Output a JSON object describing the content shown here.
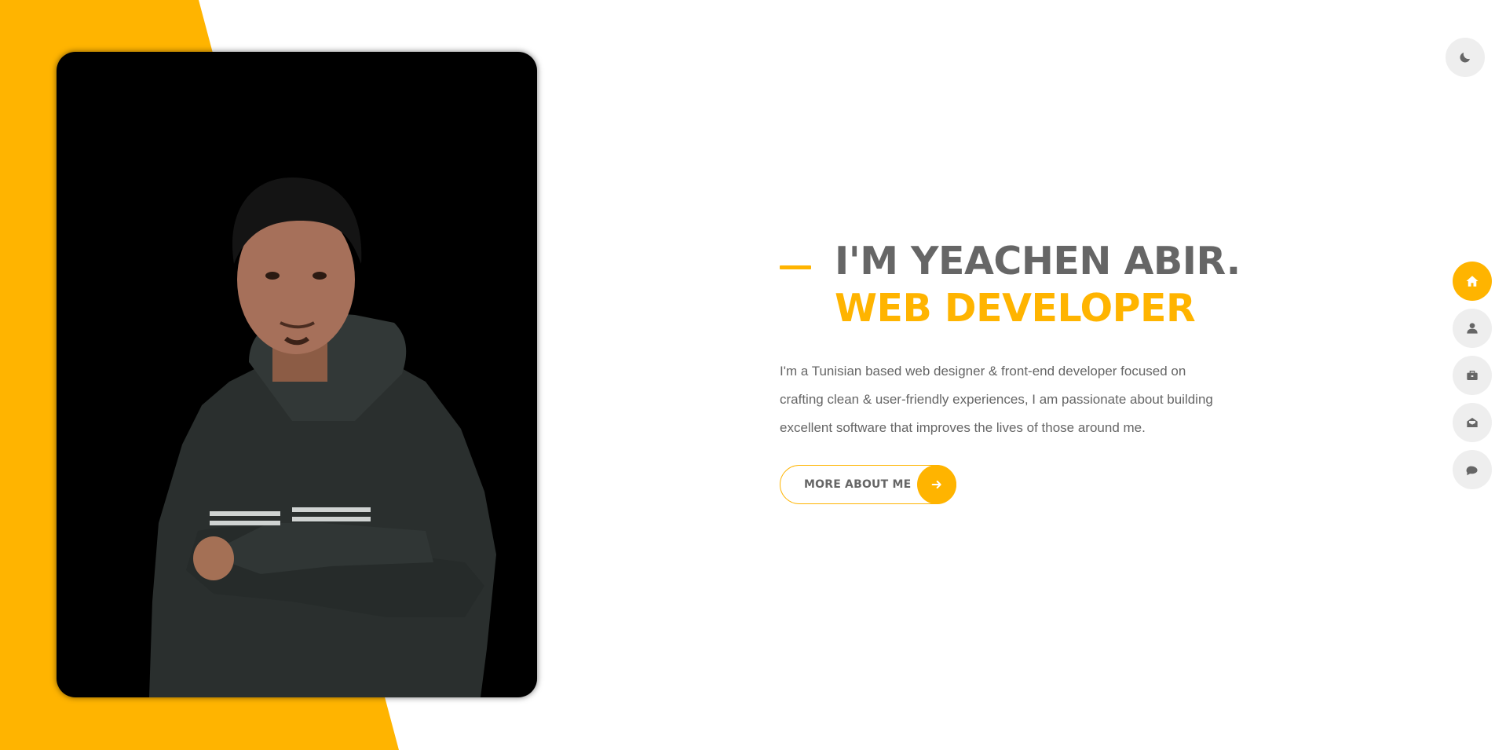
{
  "hero": {
    "name": "I'M YEACHEN ABIR.",
    "role": "WEB DEVELOPER",
    "intro": "I'm a Tunisian based web designer & front-end developer focused on crafting clean & user-friendly experiences, I am passionate about building excellent software that improves the lives of those around me.",
    "more_button": "MORE ABOUT ME"
  },
  "theme_toggle": {
    "icon": "moon-icon"
  },
  "nav": {
    "items": [
      {
        "icon": "home-icon",
        "active": true
      },
      {
        "icon": "user-icon",
        "active": false
      },
      {
        "icon": "briefcase-icon",
        "active": false
      },
      {
        "icon": "envelope-open-icon",
        "active": false
      },
      {
        "icon": "comments-icon",
        "active": false
      }
    ]
  },
  "colors": {
    "accent": "#ffb400",
    "text": "#666666",
    "button_bg": "#eeeeee"
  }
}
